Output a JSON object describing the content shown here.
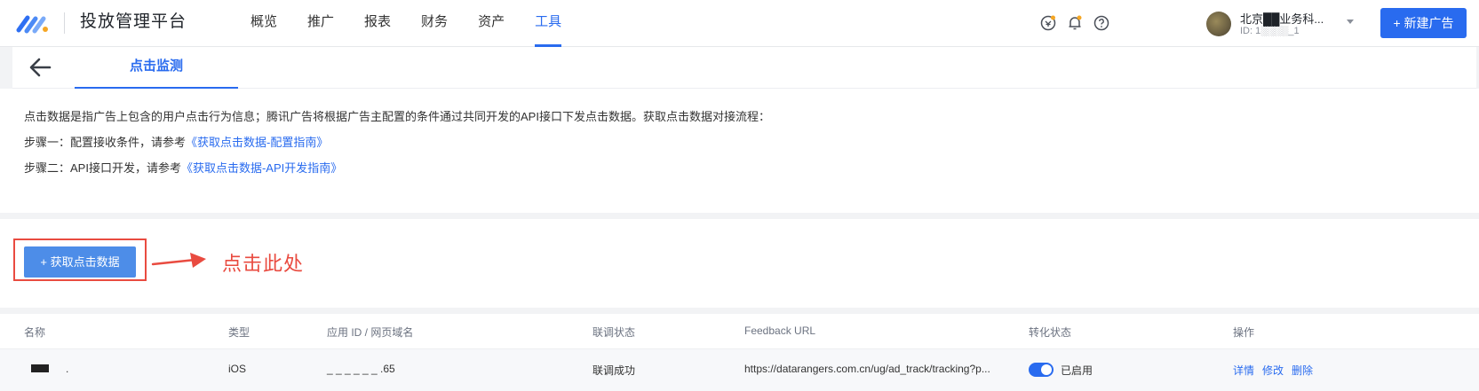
{
  "header": {
    "platform_title": "投放管理平台",
    "nav": [
      "概览",
      "推广",
      "报表",
      "财务",
      "资产",
      "工具"
    ],
    "active_nav": "工具",
    "account_name": "北京██业务科...",
    "account_id": "ID: 1░░░░_1",
    "new_ad_label": "+ 新建广告",
    "brand_color": "#296bef"
  },
  "tabs": {
    "active_label": "点击监测"
  },
  "description": {
    "intro": "点击数据是指广告上包含的用户点击行为信息；腾讯广告将根据广告主配置的条件通过共同开发的API接口下发点击数据。获取点击数据对接流程：",
    "step1_prefix": "步骤一：配置接收条件，请参考",
    "step1_link": "《获取点击数据-配置指南》",
    "step2_prefix": "步骤二：API接口开发，请参考",
    "step2_link": "《获取点击数据-API开发指南》"
  },
  "action": {
    "get_data_label": "+ 获取点击数据",
    "annotation": "点击此处",
    "annotation_color": "#e94b40"
  },
  "table": {
    "columns": [
      "名称",
      "类型",
      "应用 ID / 网页域名",
      "联调状态",
      "Feedback URL",
      "转化状态",
      "操作"
    ],
    "rows": [
      {
        "name": ".",
        "type": "iOS",
        "app_id": "_ _ _ _ _ _ .65",
        "debug_status": "联调成功",
        "feedback_url": "https://datarangers.com.cn/ug/ad_track/tracking?p...",
        "conversion_status": "已启用",
        "conversion_enabled": true,
        "actions": [
          "详情",
          "修改",
          "删除"
        ]
      }
    ]
  }
}
